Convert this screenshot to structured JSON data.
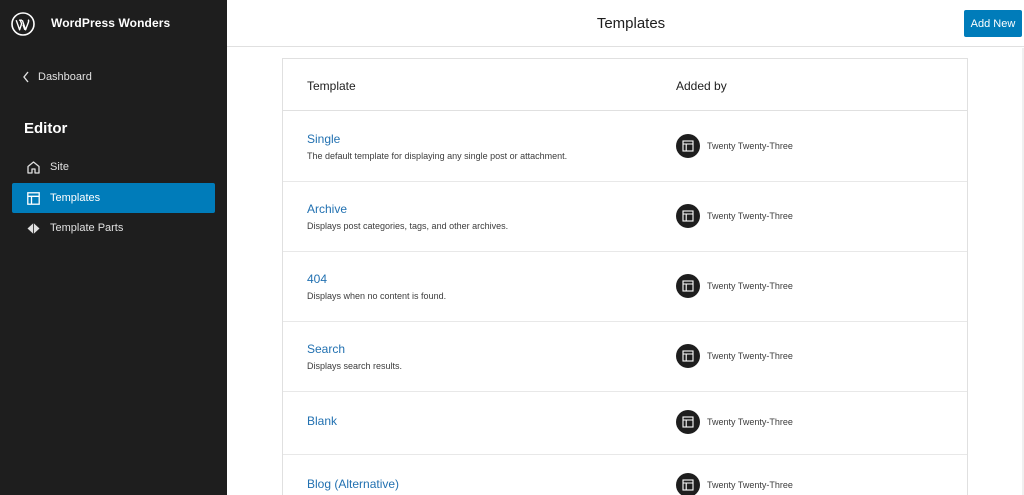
{
  "sidebar": {
    "site_name": "WordPress Wonders",
    "back_label": "Dashboard",
    "section_title": "Editor",
    "items": [
      {
        "label": "Site",
        "icon": "home-icon",
        "active": false
      },
      {
        "label": "Templates",
        "icon": "layout-icon",
        "active": true
      },
      {
        "label": "Template Parts",
        "icon": "diamond-icon",
        "active": false
      }
    ]
  },
  "header": {
    "title": "Templates",
    "add_new_label": "Add New"
  },
  "table": {
    "columns": [
      "Template",
      "Added by"
    ],
    "rows": [
      {
        "name": "Single",
        "description": "The default template for displaying any single post or attachment.",
        "added_by": "Twenty Twenty-Three"
      },
      {
        "name": "Archive",
        "description": "Displays post categories, tags, and other archives.",
        "added_by": "Twenty Twenty-Three"
      },
      {
        "name": "404",
        "description": "Displays when no content is found.",
        "added_by": "Twenty Twenty-Three"
      },
      {
        "name": "Search",
        "description": "Displays search results.",
        "added_by": "Twenty Twenty-Three"
      },
      {
        "name": "Blank",
        "description": "",
        "added_by": "Twenty Twenty-Three"
      },
      {
        "name": "Blog (Alternative)",
        "description": "",
        "added_by": "Twenty Twenty-Three"
      }
    ]
  },
  "colors": {
    "sidebar_bg": "#1e1e1e",
    "accent": "#007cba",
    "link": "#2271b1"
  }
}
